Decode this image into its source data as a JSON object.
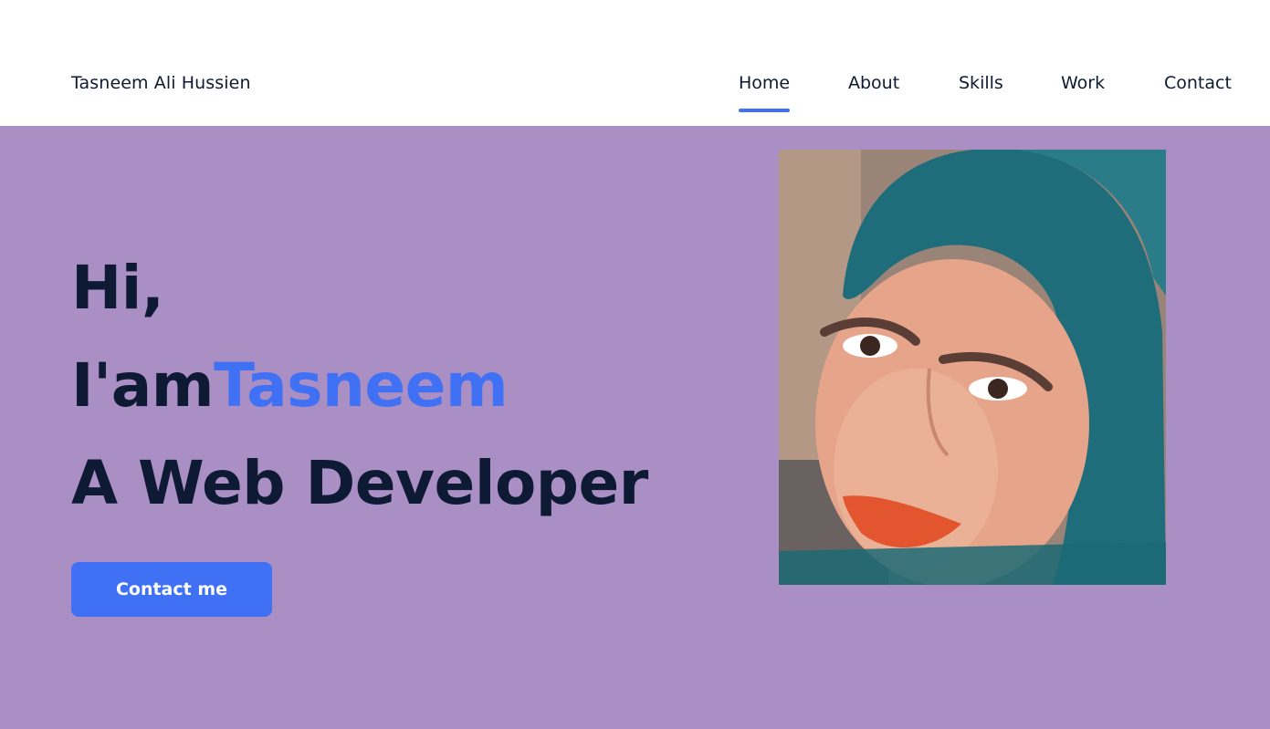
{
  "colors": {
    "accent": "#4070f4",
    "text": "#0e1a33",
    "hero_bg": "#aa8fc5"
  },
  "header": {
    "logo_text": "Tasneem Ali Hussien",
    "nav": [
      {
        "label": "Home",
        "active": true
      },
      {
        "label": "About",
        "active": false
      },
      {
        "label": "Skills",
        "active": false
      },
      {
        "label": "Work",
        "active": false
      },
      {
        "label": "Contact",
        "active": false
      }
    ]
  },
  "hero": {
    "greeting": "Hi,",
    "intro": "I'am",
    "name": "Tasneem",
    "role": "A Web Developer",
    "button_label": "Contact me",
    "photo": {
      "description_icon": "profile-photo"
    }
  }
}
